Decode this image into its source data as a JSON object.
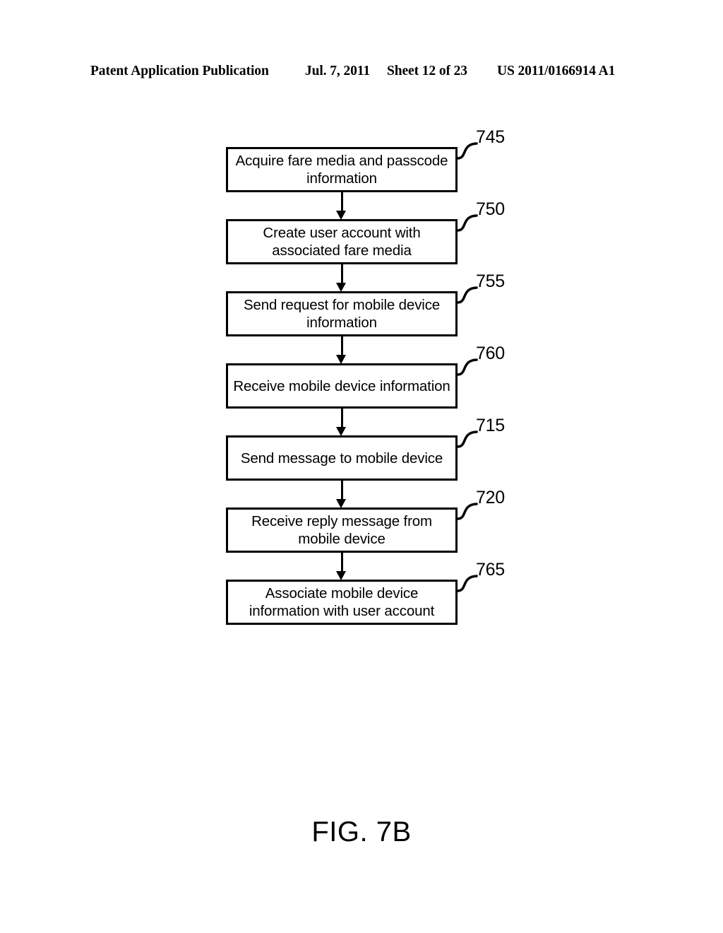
{
  "header": {
    "publication": "Patent Application Publication",
    "date": "Jul. 7, 2011",
    "sheet": "Sheet 12 of 23",
    "patent_number": "US 2011/0166914 A1"
  },
  "figure": {
    "caption": "FIG. 7B"
  },
  "flowchart": {
    "type": "flowchart",
    "orientation": "vertical",
    "nodes": [
      {
        "ref": "745",
        "text": "Acquire fare media and passcode information"
      },
      {
        "ref": "750",
        "text": "Create user account with associated fare media"
      },
      {
        "ref": "755",
        "text": "Send request for mobile device information"
      },
      {
        "ref": "760",
        "text": "Receive mobile device information"
      },
      {
        "ref": "715",
        "text": "Send message to mobile device"
      },
      {
        "ref": "720",
        "text": "Receive reply message from mobile device"
      },
      {
        "ref": "765",
        "text": "Associate mobile device information with user account"
      }
    ],
    "edges": [
      {
        "from": "745",
        "to": "750"
      },
      {
        "from": "750",
        "to": "755"
      },
      {
        "from": "755",
        "to": "760"
      },
      {
        "from": "760",
        "to": "715"
      },
      {
        "from": "715",
        "to": "720"
      },
      {
        "from": "720",
        "to": "765"
      }
    ],
    "colors": {
      "stroke": "#000000",
      "fill": "#ffffff",
      "text": "#000000"
    }
  }
}
